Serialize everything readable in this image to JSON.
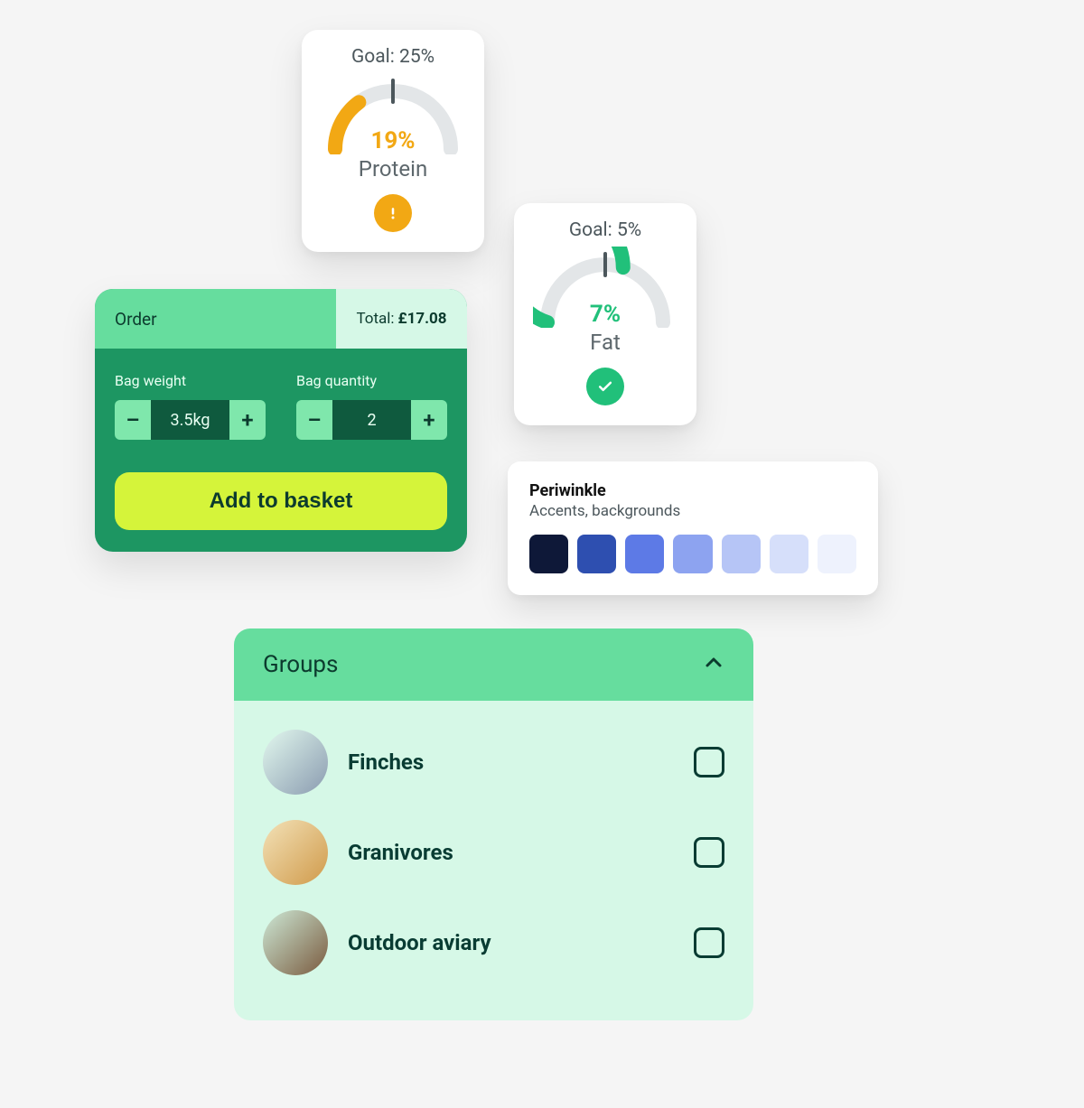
{
  "gauges": {
    "protein": {
      "goal_label": "Goal: 25%",
      "value_label": "19%",
      "name_label": "Protein",
      "value_color": "#f2a814",
      "arc_color": "#f2a814",
      "arc_fraction": 0.3,
      "badge_bg": "#f2a814",
      "badge_icon": "warning"
    },
    "fat": {
      "goal_label": "Goal: 5%",
      "value_label": "7%",
      "name_label": "Fat",
      "value_color": "#21c07a",
      "arc_color": "#21c07a",
      "arc_fraction": 0.6,
      "badge_bg": "#21c07a",
      "badge_icon": "check"
    }
  },
  "order": {
    "title": "Order",
    "total_label": "Total:",
    "total_amount": "£17.08",
    "weight_label": "Bag weight",
    "weight_value": "3.5kg",
    "quantity_label": "Bag quantity",
    "quantity_value": "2",
    "minus": "–",
    "plus": "+",
    "add_label": "Add to basket"
  },
  "palette": {
    "title": "Periwinkle",
    "subtitle": "Accents, backgrounds",
    "swatches": [
      "#0e1838",
      "#2e4fb0",
      "#5d7ae6",
      "#8da3f0",
      "#b6c5f6",
      "#d6dffa",
      "#eef2fd"
    ]
  },
  "groups": {
    "title": "Groups",
    "items": [
      {
        "label": "Finches",
        "avatar_a": "#e2f8ee",
        "avatar_b": "#8a9bb0"
      },
      {
        "label": "Granivores",
        "avatar_a": "#f3e2b8",
        "avatar_b": "#d09a4a"
      },
      {
        "label": "Outdoor aviary",
        "avatar_a": "#cde9d6",
        "avatar_b": "#7a5a3e"
      }
    ]
  },
  "chart_data": [
    {
      "type": "gauge",
      "name": "Protein",
      "value": 19,
      "goal": 25,
      "unit": "%",
      "status": "warning"
    },
    {
      "type": "gauge",
      "name": "Fat",
      "value": 7,
      "goal": 5,
      "unit": "%",
      "status": "ok"
    }
  ]
}
